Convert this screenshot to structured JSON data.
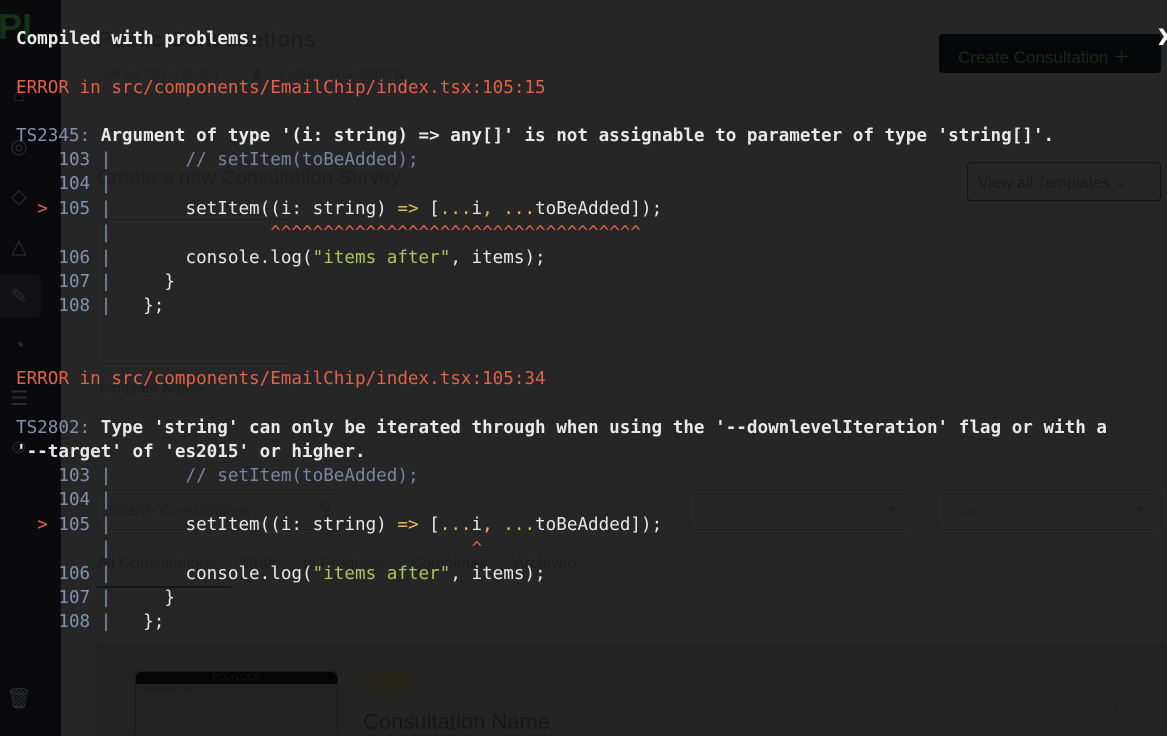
{
  "app": {
    "logo": "PL",
    "title": "Public Consultations",
    "org": "Belfast City Council",
    "open_count": "4 open consultations",
    "create_button": "Create Consultation",
    "create_section_title": "Create a new Consultation Survey",
    "view_templates": "View all Templates",
    "template_name_label": "Template Name",
    "search_placeholder": "Search Consultations",
    "sort_placeholder": "Sort",
    "tabs": [
      "All Consultations",
      "Draft",
      "In Progress",
      "Completed",
      "Archived"
    ],
    "card": {
      "thumb_brand": "POLYLOOP",
      "thumb_title": "Consultation Title",
      "status": "Draft",
      "name": "Consultation Name"
    }
  },
  "overlay": {
    "heading": "Compiled with problems:",
    "close": "X",
    "errors": [
      {
        "location": "ERROR in src/components/EmailChip/index.tsx:105:15",
        "code": "TS2345:",
        "message": " Argument of type '(i: string) => any[]' is not assignable to parameter of type 'string[]'.",
        "carets": "^^^^^^^^^^^^^^^^^^^^^^^^^^^^^^^^^^^"
      },
      {
        "location": "ERROR in src/components/EmailChip/index.tsx:105:34",
        "code": "TS2802:",
        "message": " Type 'string' can only be iterated through when using the '--downlevelIteration' flag or with a",
        "message2": "'--target' of 'es2015' or higher.",
        "carets": "^"
      }
    ],
    "lines": {
      "n103": "103",
      "n104": "104",
      "n105": "105",
      "n106": "106",
      "n107": "107",
      "n108": "108",
      "marker": ">",
      "pipe": "|",
      "l103": "// setItem(toBeAdded);",
      "l105a": "setItem((i: string) ",
      "l105b": "=>",
      "l105c": " [",
      "l105d": "...",
      "l105e": "i",
      "l105f": ", ",
      "l105g": "toBeAdded]);",
      "l106a": "console.log(",
      "l106b": "\"items after\"",
      "l106c": ", items);",
      "l107": "}",
      "l108": "};"
    }
  }
}
